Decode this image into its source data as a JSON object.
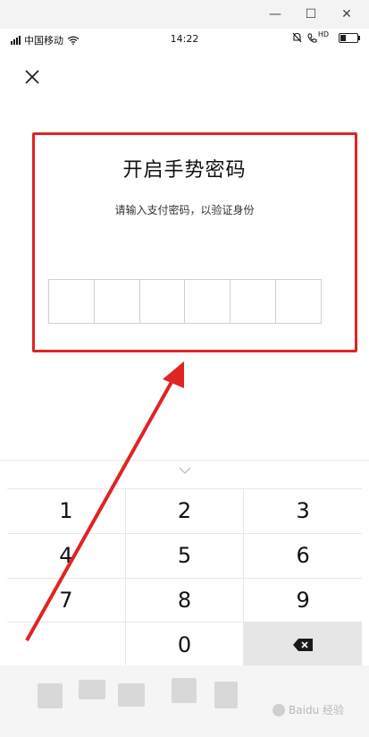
{
  "window": {
    "minimize": "—",
    "maximize": "☐",
    "close": "✕"
  },
  "status": {
    "carrier": "中国移动",
    "time": "14:22",
    "hd": "HD"
  },
  "title": "开启手势密码",
  "subtitle": "请输入支付密码，以验证身份",
  "pin_cells": 6,
  "keypad": {
    "keys": [
      "1",
      "2",
      "3",
      "4",
      "5",
      "6",
      "7",
      "8",
      "9",
      "",
      "0",
      "⌫"
    ]
  },
  "watermark": "Baidu 经验",
  "colors": {
    "highlight": "#e02424",
    "keypad_bg": "#e8e8e8",
    "delete_bg": "#e6e6e6"
  }
}
